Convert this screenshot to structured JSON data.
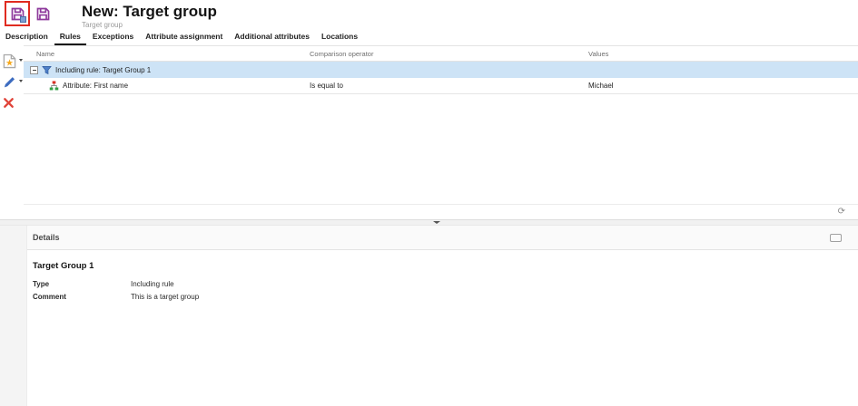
{
  "header": {
    "title": "New: Target group",
    "subtitle": "Target group"
  },
  "toolbar": {
    "buttons": [
      {
        "name": "save",
        "icon": "floppy-disk-icon",
        "highlighted": true
      },
      {
        "name": "save-variant",
        "icon": "floppy-disk-icon",
        "highlighted": false
      }
    ]
  },
  "tabs": [
    {
      "label": "Description",
      "active": false
    },
    {
      "label": "Rules",
      "active": true
    },
    {
      "label": "Exceptions",
      "active": false
    },
    {
      "label": "Attribute assignment",
      "active": false
    },
    {
      "label": "Additional attributes",
      "active": false
    },
    {
      "label": "Locations",
      "active": false
    }
  ],
  "side_toolbar": [
    {
      "name": "new",
      "icon": "new-document-icon",
      "has_dropdown": true
    },
    {
      "name": "edit",
      "icon": "pencil-icon",
      "has_dropdown": true
    },
    {
      "name": "delete",
      "icon": "red-x-icon",
      "has_dropdown": false
    }
  ],
  "table": {
    "columns": [
      "Name",
      "Comparison operator",
      "Values"
    ],
    "rows": [
      {
        "name": "Including rule: Target Group 1",
        "operator": "",
        "values": "",
        "icon": "rule-icon",
        "expanded": true,
        "selected": true,
        "indent": 0
      },
      {
        "name": "Attribute: First name",
        "operator": "Is equal to",
        "values": "Michael",
        "icon": "attribute-icon",
        "expanded": false,
        "selected": false,
        "indent": 1
      }
    ],
    "footer": {
      "refresh_glyph": "⟳"
    }
  },
  "details": {
    "header": "Details",
    "title": "Target Group 1",
    "fields": [
      {
        "label": "Type",
        "value": "Including rule"
      },
      {
        "label": "Comment",
        "value": "This is a target group"
      }
    ]
  },
  "colors": {
    "accent_purple": "#8e3a9c",
    "annotation_red": "#e02b20",
    "selected_row_blue": "#cde3f6",
    "edit_blue": "#3d6cc0",
    "delete_red": "#e0443a",
    "new_star_yellow": "#f5a81c",
    "attribute_green": "#2f9e44",
    "attribute_red": "#d93025"
  }
}
